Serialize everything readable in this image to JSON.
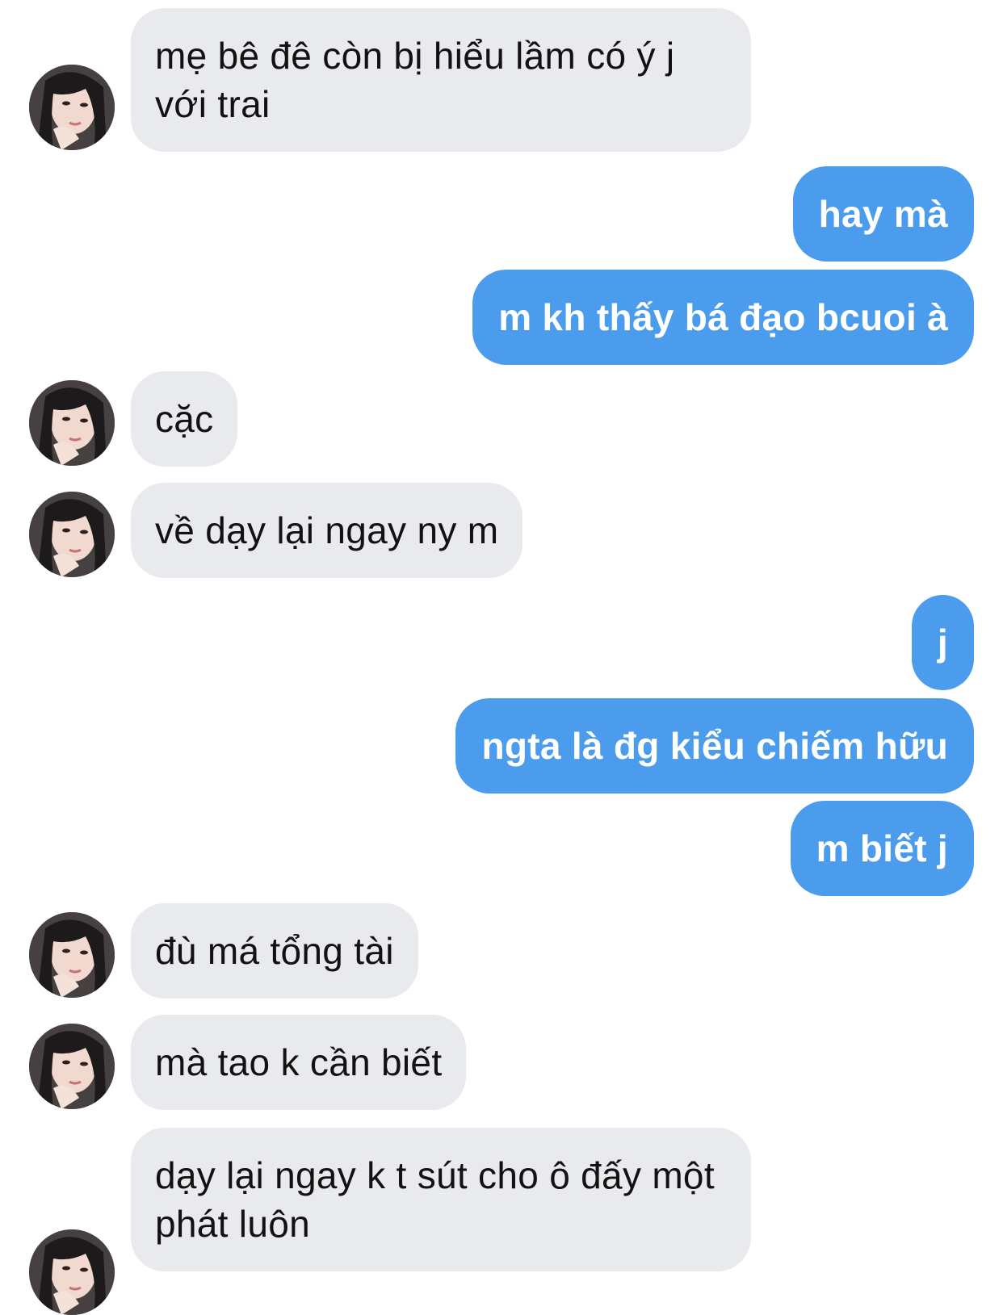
{
  "conversation": {
    "messages": [
      {
        "side": "in",
        "text": "mẹ bê đê còn bị hiểu lầm có ý j với trai"
      },
      {
        "side": "out",
        "text": "hay mà"
      },
      {
        "side": "out",
        "text": "m kh thấy bá đạo bcuoi à"
      },
      {
        "side": "in",
        "text": "cặc"
      },
      {
        "side": "in",
        "text": "về dạy lại ngay ny m"
      },
      {
        "side": "out",
        "text": "j"
      },
      {
        "side": "out",
        "text": "ngta là đg kiểu chiếm hữu"
      },
      {
        "side": "out",
        "text": "m biết j"
      },
      {
        "side": "in",
        "text": "đù má tổng tài"
      },
      {
        "side": "in",
        "text": "mà tao k cần biết"
      },
      {
        "side": "in",
        "text": "dạy lại ngay k t sút cho ô đấy một phát luôn"
      }
    ]
  },
  "colors": {
    "incoming_bubble": "#e9eaee",
    "outgoing_bubble": "#4b9cec",
    "incoming_text": "#121212",
    "outgoing_text": "#ffffff"
  },
  "icons": {
    "avatar": "contact-avatar-photo"
  }
}
